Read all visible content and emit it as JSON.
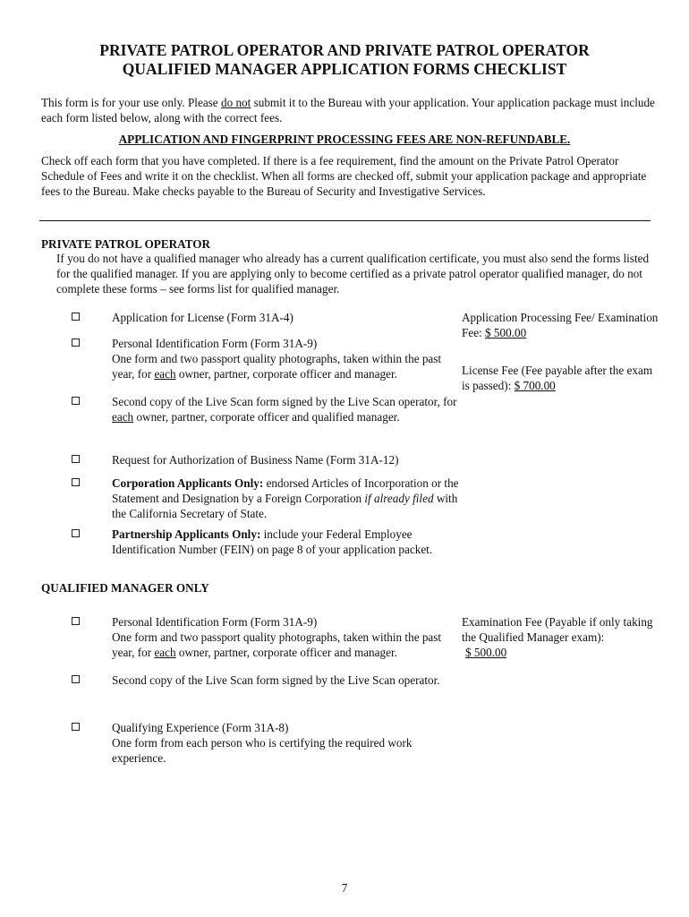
{
  "title": {
    "line1": "PRIVATE PATROL OPERATOR AND PRIVATE PATROL OPERATOR",
    "line2": "QUALIFIED MANAGER APPLICATION FORMS CHECKLIST"
  },
  "intro": {
    "part1": "This form is for your use only.  Please ",
    "emphasis": "do not",
    "part2": " submit it to the Bureau with your application.  Your application package must include each form listed below, along with the correct fees."
  },
  "warning": "APPLICATION AND FINGERPRINT PROCESSING FEES ARE NON-REFUNDABLE.",
  "instructions": "Check off each form that you have completed. If there is a fee requirement, find the amount on the Private Patrol Operator Schedule of Fees and write it on the checklist. When all forms are checked off, submit your application package and appropriate fees to the Bureau. Make checks payable to the Bureau of Security and Investigative Services.",
  "ppo": {
    "heading": "PRIVATE PATROL OPERATOR",
    "note": "If you do not have a qualified manager who already has a current qualification certificate, you must also send the forms listed for the qualified manager.  If you are applying only to become certified as a private patrol operator qualified manager, do not complete these forms – see forms list for qualified manager.",
    "items": [
      {
        "text": "Application for License (Form 31A-4)",
        "checked": false
      },
      {
        "line1": "Personal Identification Form (Form 31A-9)",
        "pre": "One form and two passport quality photographs, taken within the past year, for ",
        "u": "each",
        "post": " owner, partner, corporate officer and manager.",
        "checked": false
      },
      {
        "pre": "Second copy of the Live Scan form signed by the Live Scan operator, for ",
        "u": "each",
        "post": " owner, partner, corporate officer and qualified manager.",
        "checked": false
      },
      {
        "text": "Request for Authorization of Business Name (Form 31A-12)",
        "checked": false
      },
      {
        "bold": "Corporation Applicants Only:",
        "pre": " endorsed Articles of Incorporation or the Statement and Designation by a Foreign Corporation ",
        "italic": "if already filed",
        "post": " with the California Secretary of State.",
        "checked": false
      },
      {
        "bold": "Partnership Applicants Only:",
        "post": " include your Federal Employee Identification Number (FEIN) on page 8 of your application packet.",
        "checked": false
      }
    ],
    "fees": [
      {
        "label": "Application Processing Fee/ Examination Fee:  ",
        "amount": "$ 500.00"
      },
      {
        "label": "License Fee (Fee payable after the exam is passed): ",
        "amount": "$ 700.00"
      }
    ]
  },
  "qm": {
    "heading": "QUALIFIED MANAGER ONLY",
    "items": [
      {
        "line1": "Personal Identification Form (Form 31A-9)",
        "pre": "One form and two passport quality photographs, taken within the past year, for ",
        "u": "each",
        "post": " owner, partner, corporate officer and manager.",
        "checked": false
      },
      {
        "text": "Second copy of the Live Scan form signed by the Live Scan operator.",
        "checked": false
      },
      {
        "line1": "Qualifying Experience (Form 31A-8)",
        "text": "One form from each person who is certifying the required work experience.",
        "checked": false
      }
    ],
    "fees": [
      {
        "label": "Examination Fee (Payable if only taking the Qualified Manager exam):",
        "amount": "$ 500.00"
      }
    ]
  },
  "page_number": "7"
}
